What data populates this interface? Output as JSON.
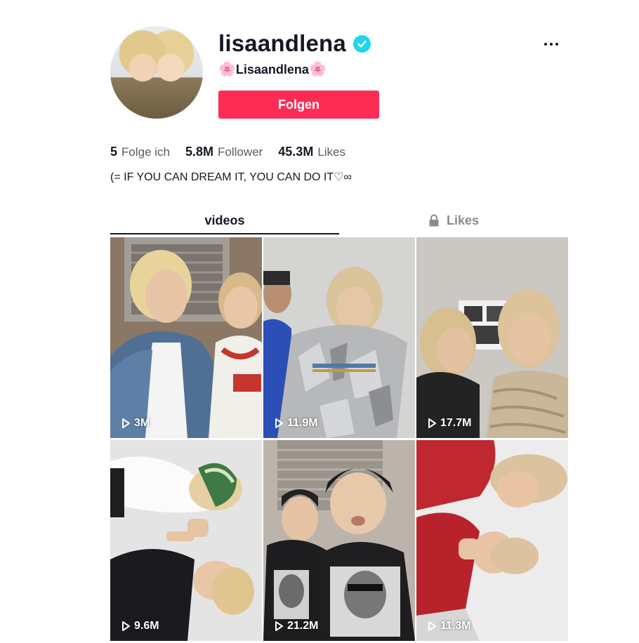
{
  "profile": {
    "username": "lisaandlena",
    "nickname_prefix": "🌸",
    "nickname": "Lisaandlena",
    "nickname_suffix": "🌸",
    "follow_label": "Folgen",
    "verified": true
  },
  "stats": {
    "following_count": "5",
    "following_label": "Folge ich",
    "followers_count": "5.8M",
    "followers_label": "Follower",
    "likes_count": "45.3M",
    "likes_label": "Likes"
  },
  "bio": "(= IF YOU CAN DREAM IT, YOU CAN DO IT♡∞",
  "tabs": {
    "videos": "videos",
    "likes": "Likes"
  },
  "videos": [
    {
      "views": "3M"
    },
    {
      "views": "11.9M"
    },
    {
      "views": "17.7M"
    },
    {
      "views": "9.6M"
    },
    {
      "views": "21.2M"
    },
    {
      "views": "11.3M"
    }
  ],
  "colors": {
    "follow_button": "#fe2c55",
    "verified_badge": "#20d5ec",
    "text_primary": "#161823",
    "text_secondary": "#8a8b91"
  },
  "icons": {
    "more": "more-dots-icon",
    "verified": "verified-check-icon",
    "lock": "lock-icon",
    "play": "play-icon"
  }
}
